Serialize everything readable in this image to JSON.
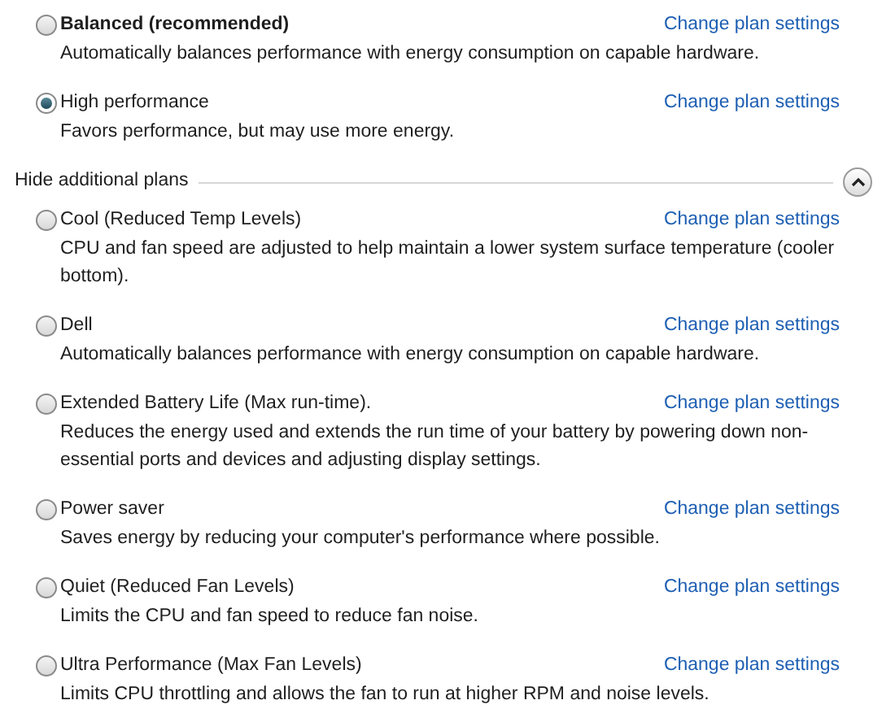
{
  "plans": [
    {
      "name": "Balanced (recommended)",
      "recommended": true,
      "selected": false,
      "description": "Automatically balances performance with energy consumption on capable hardware.",
      "link": "Change plan settings"
    },
    {
      "name": "High performance",
      "recommended": false,
      "selected": true,
      "description": "Favors performance, but may use more energy.",
      "link": "Change plan settings"
    }
  ],
  "additional_section": {
    "label": "Hide additional plans",
    "expanded": true,
    "plans": [
      {
        "name": "Cool (Reduced Temp Levels)",
        "recommended": false,
        "selected": false,
        "description": "CPU and fan speed are adjusted to help maintain a lower system surface temperature (cooler bottom).",
        "link": "Change plan settings"
      },
      {
        "name": "Dell",
        "recommended": false,
        "selected": false,
        "description": "Automatically balances performance with energy consumption on capable hardware.",
        "link": "Change plan settings"
      },
      {
        "name": "Extended Battery Life (Max run-time).",
        "recommended": false,
        "selected": false,
        "description": "Reduces the energy used and extends the run time of your battery by powering down non-essential ports and devices and adjusting display settings.",
        "link": "Change plan settings"
      },
      {
        "name": "Power saver",
        "recommended": false,
        "selected": false,
        "description": "Saves energy by reducing your computer's performance where possible.",
        "link": "Change plan settings"
      },
      {
        "name": "Quiet (Reduced Fan Levels)",
        "recommended": false,
        "selected": false,
        "description": "Limits the CPU and fan speed to reduce fan noise.",
        "link": "Change plan settings"
      },
      {
        "name": "Ultra Performance (Max Fan Levels)",
        "recommended": false,
        "selected": false,
        "description": "Limits CPU throttling and allows the fan to run at higher RPM and noise levels.",
        "link": "Change plan settings"
      }
    ]
  }
}
